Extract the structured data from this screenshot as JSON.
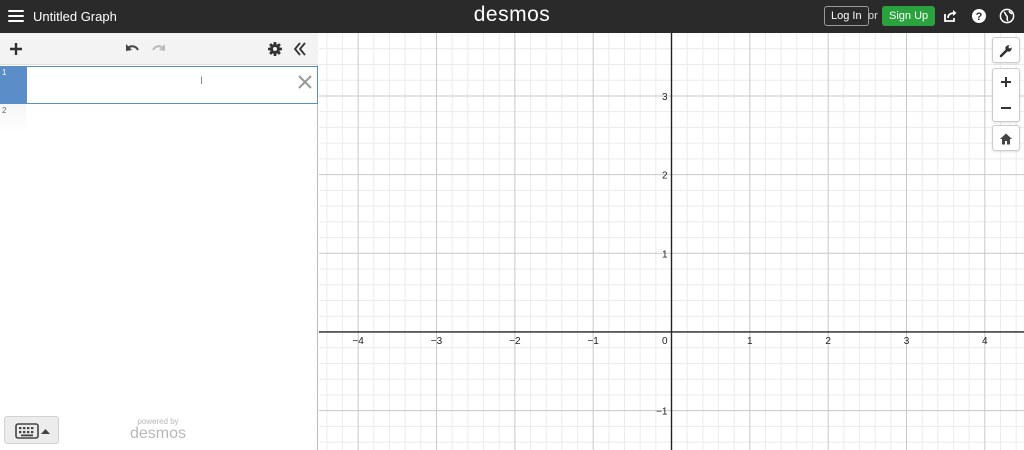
{
  "header": {
    "menu_icon": "hamburger-menu-icon",
    "title": "Untitled Graph",
    "brand": "desmos",
    "login_label": "Log In",
    "or_label": "or",
    "signup_label": "Sign Up",
    "icons": [
      "share-icon",
      "help-icon",
      "language-globe-icon"
    ]
  },
  "colors": {
    "header_bg": "#2a2a2a",
    "accent_blue": "#5b8ec9",
    "signup_green": "#2aa33e"
  },
  "toolbar": {
    "icons": [
      "add-icon",
      "undo-icon",
      "redo-icon",
      "settings-gear-icon",
      "collapse-panel-icon"
    ]
  },
  "expressions": [
    {
      "number": "1",
      "value": "",
      "active": true
    },
    {
      "number": "2",
      "value": "",
      "active": false
    }
  ],
  "panel_footer": {
    "keypad_icon": "keyboard-icon",
    "powered_by": "powered by",
    "powered_brand": "desmos"
  },
  "graph": {
    "x_ticks": [
      -4,
      -3,
      -2,
      -1,
      1,
      2,
      3,
      4
    ],
    "y_ticks": [
      3,
      2,
      1,
      -1
    ],
    "origin_label": "0",
    "x_range": [
      -4.5,
      4.5
    ],
    "y_range": [
      -1.5,
      3.8
    ],
    "grid": true
  },
  "graph_controls": [
    "wrench-icon",
    "zoom-in-icon",
    "zoom-out-icon",
    "home-icon"
  ]
}
